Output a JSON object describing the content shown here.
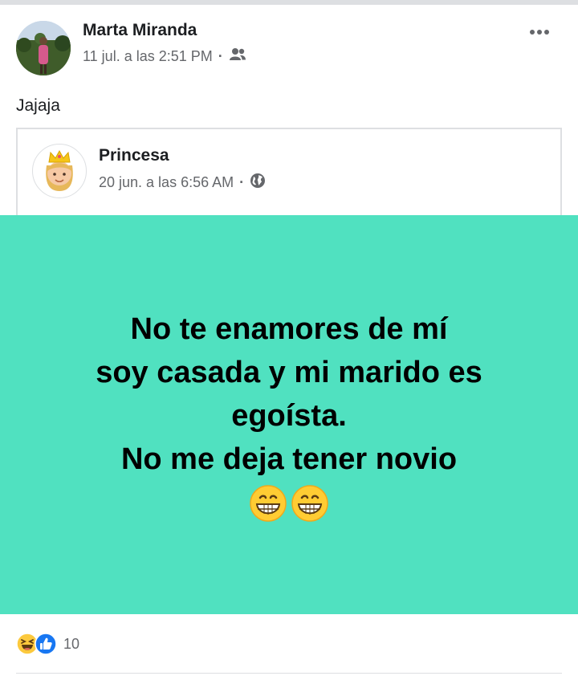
{
  "post": {
    "author_name": "Marta Miranda",
    "timestamp": "11 jul. a las 2:51 PM",
    "separator": "·",
    "audience_icon": "friends-icon",
    "more_icon": "more-horizontal-icon",
    "text": "Jajaja"
  },
  "shared_post": {
    "author_name": "Princesa",
    "timestamp": "20 jun. a las 6:56 AM",
    "separator": "·",
    "audience_icon": "globe-icon",
    "avatar_icon": "princess-emoji-icon",
    "image": {
      "background_color": "#50e1c0",
      "lines": [
        "No te enamores de mí",
        "soy casada y mi marido es",
        "egoísta.",
        "No me deja tener novio"
      ],
      "emoji_icons": [
        "grinning-face-icon",
        "grinning-face-icon"
      ]
    }
  },
  "reactions": {
    "icons": [
      "haha-reaction-icon",
      "like-reaction-icon"
    ],
    "count": "10"
  },
  "colors": {
    "secondary_text": "#65676b",
    "primary_text": "#1c1e21",
    "like_blue": "#1877f2"
  }
}
